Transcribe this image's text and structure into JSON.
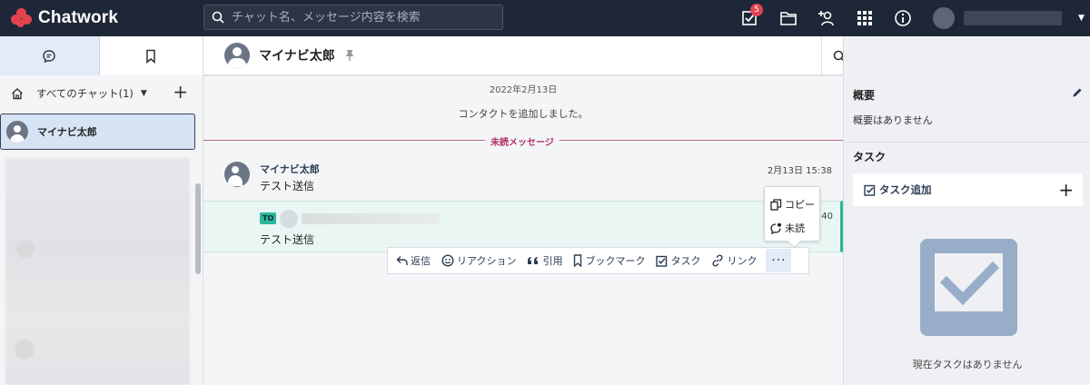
{
  "app": {
    "name": "Chatwork",
    "brand_color": "#e2434f",
    "header_bg": "#1e2737",
    "accent_color": "#2ab89a"
  },
  "header": {
    "search_placeholder": "チャット名、メッセージ内容を検索",
    "task_badge": "5",
    "icons": [
      "search-icon",
      "task-check-icon",
      "folder-icon",
      "add-contact-icon",
      "apps-grid-icon",
      "info-icon",
      "user-avatar",
      "caret-down-icon"
    ]
  },
  "sidebar": {
    "tabs": [
      {
        "name": "chat-tab",
        "icon": "chat-bubble-icon",
        "active": true
      },
      {
        "name": "bookmark-tab",
        "icon": "bookmark-icon",
        "active": false
      }
    ],
    "filter_label": "すべてのチャット(1)",
    "filter_caret": "▼",
    "add_label": "+",
    "rooms": [
      {
        "name": "マイナビ太郎",
        "selected": true
      }
    ]
  },
  "room": {
    "title": "マイナビ太郎",
    "date_separator": "2022年2月13日",
    "system_message": "コンタクトを追加しました。",
    "unread_label": "未読メッセージ",
    "messages": [
      {
        "sender": "マイナビ太郎",
        "time": "2月13日 15:38",
        "body": "テスト送信"
      },
      {
        "to_tag": "TO",
        "time_partial": "40",
        "body": "テスト送信"
      }
    ],
    "actions": {
      "reply": "返信",
      "reaction": "リアクション",
      "quote": "引用",
      "bookmark": "ブックマーク",
      "task": "タスク",
      "link": "リンク",
      "more": "···"
    },
    "more_menu": {
      "copy": "コピー",
      "unread": "未読"
    }
  },
  "right_panel": {
    "summary_title": "概要",
    "summary_text": "概要はありません",
    "task_title": "タスク",
    "task_add_label": "タスク追加",
    "task_add_plus": "+",
    "empty_text": "現在タスクはありません"
  }
}
